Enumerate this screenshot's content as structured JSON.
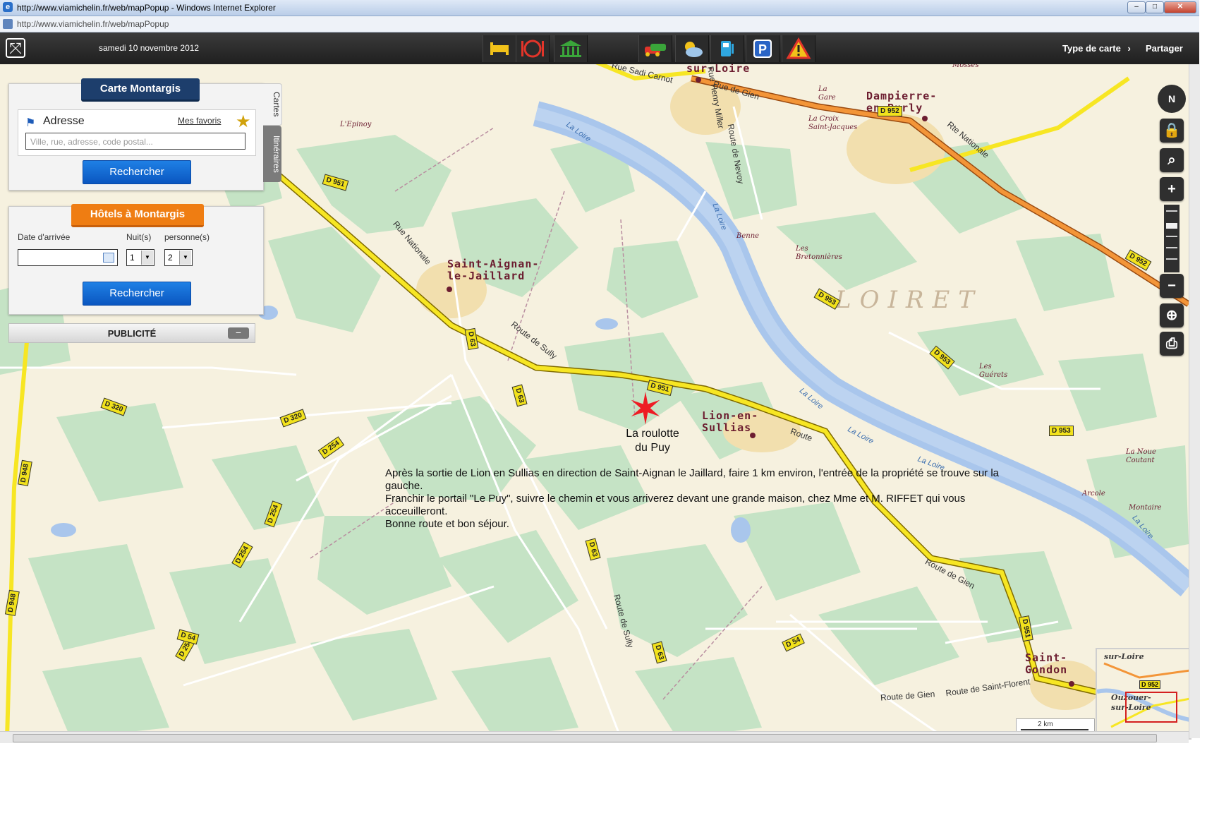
{
  "browser": {
    "title": "http://www.viamichelin.fr/web/mapPopup - Windows Internet Explorer",
    "url": "http://www.viamichelin.fr/web/mapPopup"
  },
  "toolbar": {
    "date": "samedi 10 novembre 2012",
    "map_type_label": "Type de carte",
    "share_label": "Partager",
    "icons": [
      "hotel-icon",
      "restaurant-icon",
      "museum-icon",
      "traffic-icon",
      "weather-icon",
      "fuel-icon",
      "parking-icon",
      "warning-icon"
    ]
  },
  "address_panel": {
    "tab_title": "Carte Montargis",
    "heading": "Adresse",
    "favorites_link": "Mes favoris",
    "input_placeholder": "Ville, rue, adresse, code postal...",
    "search_button": "Rechercher"
  },
  "side_tabs": {
    "maps": "Cartes",
    "routes": "Itinéraires"
  },
  "hotels_panel": {
    "tab_title": "Hôtels à Montargis",
    "arrival_label": "Date d'arrivée",
    "nights_label": "Nuit(s)",
    "persons_label": "personne(s)",
    "nights_value": "1",
    "persons_value": "2",
    "search_button": "Rechercher"
  },
  "ad_bar": {
    "label": "PUBLICITÉ"
  },
  "map": {
    "marker_label": [
      "La roulotte",
      "du Puy"
    ],
    "directions": [
      "Après la sortie de Lion en Sullias en direction de Saint-Aignan le Jaillard, faire 1 km environ, l'entrée de la propriété se trouve sur la gauche.",
      "Franchir le portail \"Le Puy\", suivre le chemin et vous arriverez devant une grande maison, chez Mme et M. RIFFET qui vous acceuilleront.",
      "Bonne route et bon séjour."
    ],
    "places": {
      "sur_loire": "sur-Loire",
      "dampierre": [
        "Dampierre-",
        "en-Burly"
      ],
      "saint_aignan": [
        "Saint-Aignan-",
        "le-Jaillard"
      ],
      "lion": [
        "Lion-en-",
        "Sullias"
      ],
      "saint_gondon": [
        "Saint-",
        "Gondon"
      ]
    },
    "minor_places": {
      "epinoy": "L'Epinoy",
      "gare": [
        "La",
        "Gare"
      ],
      "croix": [
        "La Croix",
        "Saint-Jacques"
      ],
      "benne": "Benne",
      "bretonnieres": [
        "Les",
        "Bretonnières"
      ],
      "guerets": [
        "Les",
        "Guérets"
      ],
      "noue": [
        "La Noue",
        "Coutant"
      ],
      "arcole": "Arcole",
      "montaire": "Montaire",
      "mosses": "Mosses"
    },
    "region": "LOIRET",
    "roads": {
      "d951": "D 951",
      "d952": "D 952",
      "d953": "D 953",
      "d63": "D 63",
      "d320": "D 320",
      "d254": "D 254",
      "d948": "D 948",
      "d54": "D 54"
    },
    "streets": {
      "sadi_carnot": "Rue Sadi Carnot",
      "rue_de_gien": "Rue de Gien",
      "henry_miller": "Rue Henry Miller",
      "route_nevoy": "Route de Nevoy",
      "rte_nationale": "Rte Nationale",
      "rue_nationale": "Rue Nationale",
      "route_sully": "Route de Sully",
      "route": "Route",
      "route_de_gien": "Route de Gien",
      "route_de_gien2": "Route de Gien",
      "route_st_florent": "Route de Saint-Florent",
      "route_de_sully_vert": "Route de Sully"
    },
    "river": "La Loire",
    "scale": "2 km",
    "overview": {
      "place1": "sur-Loire",
      "place2": "Ouzouer-",
      "place3": "sur-Loire",
      "road": "D 952"
    }
  },
  "controls": {
    "compass": "N",
    "zoom_in": "+",
    "zoom_out": "−"
  }
}
